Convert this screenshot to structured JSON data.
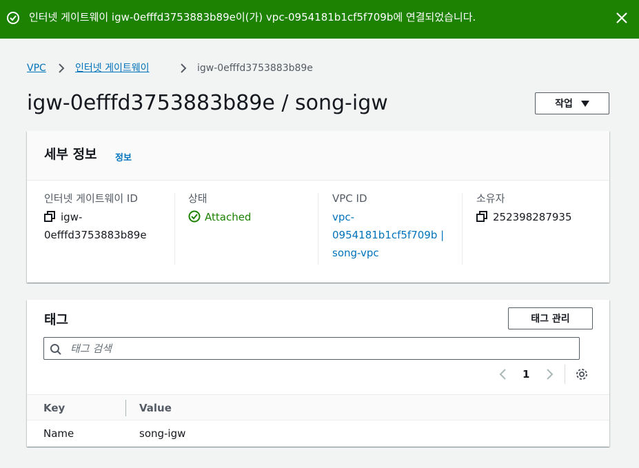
{
  "flash": {
    "message": "인터넷 게이트웨이 igw-0efffd3753883b89e이(가) vpc-0954181b1cf5f709b에 연결되었습니다.",
    "colors": {
      "background": "#1d8102",
      "text": "#ffffff"
    },
    "icons": {
      "status": "check-circle-icon",
      "dismiss": "close-icon"
    }
  },
  "breadcrumb": {
    "items": [
      {
        "label": "VPC"
      },
      {
        "label": "인터넷 게이트웨이"
      },
      {
        "label": "igw-0efffd3753883b89e"
      }
    ]
  },
  "page": {
    "title": "igw-0efffd3753883b89e / song-igw",
    "actions_label": "작업"
  },
  "details": {
    "heading": "세부 정보",
    "info_link": "정보",
    "igw_id_label": "인터넷 게이트웨이 ID",
    "igw_id_line1": "igw-",
    "igw_id_line2": "0efffd3753883b89e",
    "state_label": "상태",
    "state_value": "Attached",
    "vpc_id_label": "VPC ID",
    "vpc_line1": "vpc-",
    "vpc_line2": "0954181b1cf5f709b |",
    "vpc_line3": "song-vpc",
    "owner_label": "소유자",
    "owner_value": "252398287935"
  },
  "tags": {
    "heading": "태그",
    "manage_label": "태그 관리",
    "search_placeholder": "태그 검색",
    "page_number": "1",
    "columns": [
      "Key",
      "Value"
    ],
    "rows": [
      {
        "key": "Name",
        "value": "song-igw"
      }
    ]
  },
  "colors": {
    "link": "#0073bb",
    "success": "#1d8102",
    "page_bg": "#f2f3f3"
  }
}
